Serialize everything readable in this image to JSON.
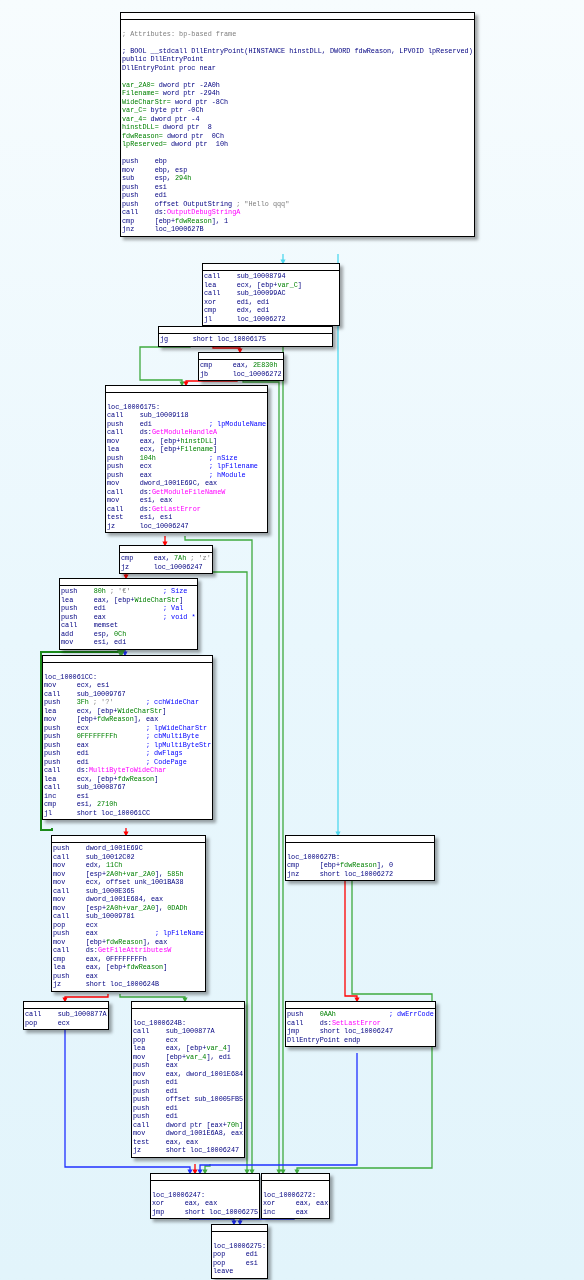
{
  "graph": {
    "blocks": [
      {
        "lines": [
          {
            "text": [
              {
                "kind": "note",
                "text": "; Attributes: bp-based frame"
              }
            ],
            "gap": true
          },
          {
            "text": [
              "; BOOL __stdcall DllEntryPoint(HINSTANCE hinstDLL, DWORD fdwReason, LPVOID lpReserved)"
            ],
            "gap": true
          },
          {
            "text": [
              "public DllEntryPoint"
            ]
          },
          {
            "text": [
              "DllEntryPoint proc near"
            ]
          },
          {
            "text": [
              {
                "kind": "var",
                "text": "var_2A0="
              },
              " dword ptr -2A0h"
            ],
            "gap": true
          },
          {
            "text": [
              {
                "kind": "var",
                "text": "Filename="
              },
              " word ptr -294h"
            ]
          },
          {
            "text": [
              {
                "kind": "var",
                "text": "WideCharStr="
              },
              " word ptr -8Ch"
            ]
          },
          {
            "text": [
              {
                "kind": "var",
                "text": "var_C="
              },
              " byte ptr -0Ch"
            ]
          },
          {
            "text": [
              {
                "kind": "var",
                "text": "var_4="
              },
              " dword ptr -4"
            ]
          },
          {
            "text": [
              {
                "kind": "var",
                "text": "hinstDLL="
              },
              " dword ptr  8"
            ]
          },
          {
            "text": [
              {
                "kind": "var",
                "text": "fdwReason="
              },
              " dword ptr  0Ch"
            ]
          },
          {
            "text": [
              {
                "kind": "var",
                "text": "lpReserved="
              },
              " dword ptr  10h"
            ]
          },
          {
            "op": "push",
            "args": [
              "ebp"
            ],
            "gap": true
          },
          {
            "op": "mov",
            "args": [
              "ebp, esp"
            ]
          },
          {
            "op": "sub",
            "args": [
              "esp, ",
              {
                "kind": "num",
                "text": "294h"
              }
            ]
          },
          {
            "op": "push",
            "args": [
              "esi"
            ]
          },
          {
            "op": "push",
            "args": [
              "edi"
            ]
          },
          {
            "op": "push",
            "args": [
              "offset OutputString"
            ],
            "comment": [
              {
                "kind": "note",
                "text": "; \"Hello qqq\""
              }
            ]
          },
          {
            "op": "call",
            "args": [
              "ds:",
              {
                "kind": "api",
                "text": "OutputDebugStringA"
              }
            ]
          },
          {
            "op": "cmp",
            "args": [
              "[ebp+",
              {
                "kind": "var",
                "text": "fdwReason"
              },
              "], 1"
            ]
          },
          {
            "op": "jnz",
            "args": [
              "loc_1000627B"
            ]
          }
        ]
      },
      {
        "lines": [
          {
            "op": "call",
            "args": [
              "sub_10008794"
            ]
          },
          {
            "op": "lea",
            "args": [
              "ecx, [ebp+",
              {
                "kind": "var",
                "text": "var_C"
              },
              "]"
            ]
          },
          {
            "op": "call",
            "args": [
              "sub_100099AC"
            ]
          },
          {
            "op": "xor",
            "args": [
              "edi, edi"
            ]
          },
          {
            "op": "cmp",
            "args": [
              "edx, edi"
            ]
          },
          {
            "op": "jl",
            "args": [
              "loc_10006272"
            ]
          }
        ]
      },
      {
        "lines": [
          {
            "op": "jg",
            "args": [
              "short loc_10006175"
            ]
          }
        ]
      },
      {
        "lines": [
          {
            "op": "cmp",
            "args": [
              "eax, ",
              {
                "kind": "num",
                "text": "2E830h"
              }
            ]
          },
          {
            "op": "jb",
            "args": [
              "loc_10006272"
            ]
          }
        ]
      },
      {
        "lines": [
          {
            "text": [
              "loc_10006175:"
            ],
            "gap": true
          },
          {
            "op": "call",
            "args": [
              "sub_10009118"
            ]
          },
          {
            "op": "push",
            "args": [
              "edi"
            ],
            "comment": [
              {
                "kind": "cmt",
                "text": "; lpModuleName"
              }
            ]
          },
          {
            "op": "call",
            "args": [
              "ds:",
              {
                "kind": "api",
                "text": "GetModuleHandleA"
              }
            ]
          },
          {
            "op": "mov",
            "args": [
              "eax, [ebp+",
              {
                "kind": "var",
                "text": "hinstDLL"
              },
              "]"
            ]
          },
          {
            "op": "lea",
            "args": [
              "ecx, [ebp+",
              {
                "kind": "var",
                "text": "Filename"
              },
              "]"
            ]
          },
          {
            "op": "push",
            "args": [
              {
                "kind": "num",
                "text": "104h"
              }
            ],
            "comment": [
              {
                "kind": "cmt",
                "text": "; nSize"
              }
            ]
          },
          {
            "op": "push",
            "args": [
              "ecx"
            ],
            "comment": [
              {
                "kind": "cmt",
                "text": "; lpFilename"
              }
            ]
          },
          {
            "op": "push",
            "args": [
              "eax"
            ],
            "comment": [
              {
                "kind": "cmt",
                "text": "; hModule"
              }
            ]
          },
          {
            "op": "mov",
            "args": [
              "dword_1001E69C, eax"
            ]
          },
          {
            "op": "call",
            "args": [
              "ds:",
              {
                "kind": "api",
                "text": "GetModuleFileNameW"
              }
            ]
          },
          {
            "op": "mov",
            "args": [
              "esi, eax"
            ]
          },
          {
            "op": "call",
            "args": [
              "ds:",
              {
                "kind": "api",
                "text": "GetLastError"
              }
            ]
          },
          {
            "op": "test",
            "args": [
              "esi, esi"
            ]
          },
          {
            "op": "jz",
            "args": [
              "loc_10006247"
            ]
          }
        ]
      },
      {
        "lines": [
          {
            "op": "cmp",
            "args": [
              "eax, ",
              {
                "kind": "num",
                "text": "7Ah"
              },
              {
                "kind": "note",
                "text": " ; 'z'"
              }
            ]
          },
          {
            "op": "jz",
            "args": [
              "loc_10006247"
            ]
          }
        ]
      },
      {
        "lines": [
          {
            "op": "push",
            "args": [
              {
                "kind": "num",
                "text": "80h"
              },
              {
                "kind": "note",
                "text": " ; '€'"
              }
            ],
            "comment": [
              {
                "kind": "cmt",
                "text": "; Size"
              }
            ]
          },
          {
            "op": "lea",
            "args": [
              "eax, [ebp+",
              {
                "kind": "var",
                "text": "WideCharStr"
              },
              "]"
            ]
          },
          {
            "op": "push",
            "args": [
              "edi"
            ],
            "comment": [
              {
                "kind": "cmt",
                "text": "; Val"
              }
            ]
          },
          {
            "op": "push",
            "args": [
              "eax"
            ],
            "comment": [
              {
                "kind": "cmt",
                "text": "; void *"
              }
            ]
          },
          {
            "op": "call",
            "args": [
              "memset"
            ]
          },
          {
            "op": "add",
            "args": [
              "esp, ",
              {
                "kind": "num",
                "text": "0Ch"
              }
            ]
          },
          {
            "op": "mov",
            "args": [
              "esi, edi"
            ]
          }
        ]
      },
      {
        "lines": [
          {
            "text": [
              "loc_100061CC:"
            ],
            "gap": true
          },
          {
            "op": "mov",
            "args": [
              "ecx, esi"
            ]
          },
          {
            "op": "call",
            "args": [
              "sub_10009767"
            ]
          },
          {
            "op": "push",
            "args": [
              {
                "kind": "num",
                "text": "3Fh"
              },
              {
                "kind": "note",
                "text": " ; '?'"
              }
            ],
            "comment": [
              {
                "kind": "cmt",
                "text": "; cchWideChar"
              }
            ]
          },
          {
            "op": "lea",
            "args": [
              "ecx, [ebp+",
              {
                "kind": "var",
                "text": "WideCharStr"
              },
              "]"
            ]
          },
          {
            "op": "mov",
            "args": [
              "[ebp+",
              {
                "kind": "var",
                "text": "fdwReason"
              },
              "], eax"
            ]
          },
          {
            "op": "push",
            "args": [
              "ecx"
            ],
            "comment": [
              {
                "kind": "cmt",
                "text": "; lpWideCharStr"
              }
            ]
          },
          {
            "op": "push",
            "args": [
              {
                "kind": "num",
                "text": "0FFFFFFFFh"
              }
            ],
            "comment": [
              {
                "kind": "cmt",
                "text": "; cbMultiByte"
              }
            ]
          },
          {
            "op": "push",
            "args": [
              "eax"
            ],
            "comment": [
              {
                "kind": "cmt",
                "text": "; lpMultiByteStr"
              }
            ]
          },
          {
            "op": "push",
            "args": [
              "edi"
            ],
            "comment": [
              {
                "kind": "cmt",
                "text": "; dwFlags"
              }
            ]
          },
          {
            "op": "push",
            "args": [
              "edi"
            ],
            "comment": [
              {
                "kind": "cmt",
                "text": "; CodePage"
              }
            ]
          },
          {
            "op": "call",
            "args": [
              "ds:",
              {
                "kind": "api",
                "text": "MultiByteToWideChar"
              }
            ]
          },
          {
            "op": "lea",
            "args": [
              "ecx, [ebp+",
              {
                "kind": "var",
                "text": "fdwReason"
              },
              "]"
            ]
          },
          {
            "op": "call",
            "args": [
              "sub_10008767"
            ]
          },
          {
            "op": "inc",
            "args": [
              "esi"
            ]
          },
          {
            "op": "cmp",
            "args": [
              "esi, ",
              {
                "kind": "num",
                "text": "2710h"
              }
            ]
          },
          {
            "op": "jl",
            "args": [
              "short loc_100061CC"
            ]
          }
        ]
      },
      {
        "lines": [
          {
            "op": "push",
            "args": [
              "dword_1001E69C"
            ]
          },
          {
            "op": "call",
            "args": [
              "sub_10012C02"
            ]
          },
          {
            "op": "mov",
            "args": [
              "edx, ",
              {
                "kind": "num",
                "text": "11Ch"
              }
            ]
          },
          {
            "op": "mov",
            "args": [
              "[esp+",
              {
                "kind": "var",
                "text": "2A0h+var_2A0"
              },
              "], ",
              {
                "kind": "num",
                "text": "585h"
              }
            ]
          },
          {
            "op": "mov",
            "args": [
              "ecx, offset unk_1001BA38"
            ]
          },
          {
            "op": "call",
            "args": [
              "sub_1000E365"
            ]
          },
          {
            "op": "mov",
            "args": [
              "dword_1001E684, eax"
            ]
          },
          {
            "op": "mov",
            "args": [
              "[esp+",
              {
                "kind": "var",
                "text": "2A0h+var_2A0"
              },
              "], ",
              {
                "kind": "num",
                "text": "0DADh"
              }
            ]
          },
          {
            "op": "call",
            "args": [
              "sub_10009781"
            ]
          },
          {
            "op": "pop",
            "args": [
              "ecx"
            ]
          },
          {
            "op": "push",
            "args": [
              "eax"
            ],
            "comment": [
              {
                "kind": "cmt",
                "text": "; lpFileName"
              }
            ]
          },
          {
            "op": "mov",
            "args": [
              "[ebp+",
              {
                "kind": "var",
                "text": "fdwReason"
              },
              "], eax"
            ]
          },
          {
            "op": "call",
            "args": [
              "ds:",
              {
                "kind": "api",
                "text": "GetFileAttributesW"
              }
            ]
          },
          {
            "op": "cmp",
            "args": [
              "eax, 0FFFFFFFFh"
            ]
          },
          {
            "op": "lea",
            "args": [
              "eax, [ebp+",
              {
                "kind": "var",
                "text": "fdwReason"
              },
              "]"
            ]
          },
          {
            "op": "push",
            "args": [
              "eax"
            ]
          },
          {
            "op": "jz",
            "args": [
              "short loc_1000624B"
            ]
          }
        ]
      },
      {
        "lines": [
          {
            "text": [
              "loc_1000627B:"
            ],
            "gap": true
          },
          {
            "op": "cmp",
            "args": [
              "[ebp+",
              {
                "kind": "var",
                "text": "fdwReason"
              },
              "], 0"
            ]
          },
          {
            "op": "jnz",
            "args": [
              "short loc_10006272"
            ]
          }
        ]
      },
      {
        "lines": [
          {
            "op": "call",
            "args": [
              "sub_1000877A"
            ]
          },
          {
            "op": "pop",
            "args": [
              "ecx"
            ]
          }
        ]
      },
      {
        "lines": [
          {
            "text": [
              "loc_1000624B:"
            ],
            "gap": true
          },
          {
            "op": "call",
            "args": [
              "sub_1000877A"
            ]
          },
          {
            "op": "pop",
            "args": [
              "ecx"
            ]
          },
          {
            "op": "lea",
            "args": [
              "eax, [ebp+",
              {
                "kind": "var",
                "text": "var_4"
              },
              "]"
            ]
          },
          {
            "op": "mov",
            "args": [
              "[ebp+",
              {
                "kind": "var",
                "text": "var_4"
              },
              "], edi"
            ]
          },
          {
            "op": "push",
            "args": [
              "eax"
            ]
          },
          {
            "op": "mov",
            "args": [
              "eax, dword_1001E684"
            ]
          },
          {
            "op": "push",
            "args": [
              "edi"
            ]
          },
          {
            "op": "push",
            "args": [
              "edi"
            ]
          },
          {
            "op": "push",
            "args": [
              "offset sub_10005FB5"
            ]
          },
          {
            "op": "push",
            "args": [
              "edi"
            ]
          },
          {
            "op": "push",
            "args": [
              "edi"
            ]
          },
          {
            "op": "call",
            "args": [
              "dword ptr [eax+",
              {
                "kind": "num",
                "text": "70h"
              },
              "]"
            ]
          },
          {
            "op": "mov",
            "args": [
              "dword_1001E6A8, eax"
            ]
          },
          {
            "op": "test",
            "args": [
              "eax, eax"
            ]
          },
          {
            "op": "jz",
            "args": [
              "short loc_10006247"
            ]
          }
        ]
      },
      {
        "lines": [
          {
            "op": "push",
            "args": [
              {
                "kind": "num",
                "text": "0AAh"
              }
            ],
            "comment": [
              {
                "kind": "cmt",
                "text": "; dwErrCode"
              }
            ]
          },
          {
            "op": "call",
            "args": [
              "ds:",
              {
                "kind": "api",
                "text": "SetLastError"
              }
            ]
          },
          {
            "op": "jmp",
            "args": [
              "short loc_10006247"
            ]
          },
          {
            "text": [
              "DllEntryPoint endp"
            ]
          }
        ]
      },
      {
        "lines": [
          {
            "text": [
              "loc_10006247:"
            ],
            "gap": true
          },
          {
            "op": "xor",
            "args": [
              "eax, eax"
            ]
          },
          {
            "op": "jmp",
            "args": [
              "short loc_10006275"
            ]
          }
        ]
      },
      {
        "lines": [
          {
            "text": [
              "loc_10006272:"
            ],
            "gap": true
          },
          {
            "op": "xor",
            "args": [
              "eax, eax"
            ]
          },
          {
            "op": "inc",
            "args": [
              "eax"
            ]
          }
        ]
      },
      {
        "lines": [
          {
            "text": [
              "loc_10006275:"
            ],
            "gap": true
          },
          {
            "op": "pop",
            "args": [
              "edi"
            ]
          },
          {
            "op": "pop",
            "args": [
              "esi"
            ]
          },
          {
            "op": "leave"
          }
        ]
      }
    ]
  }
}
